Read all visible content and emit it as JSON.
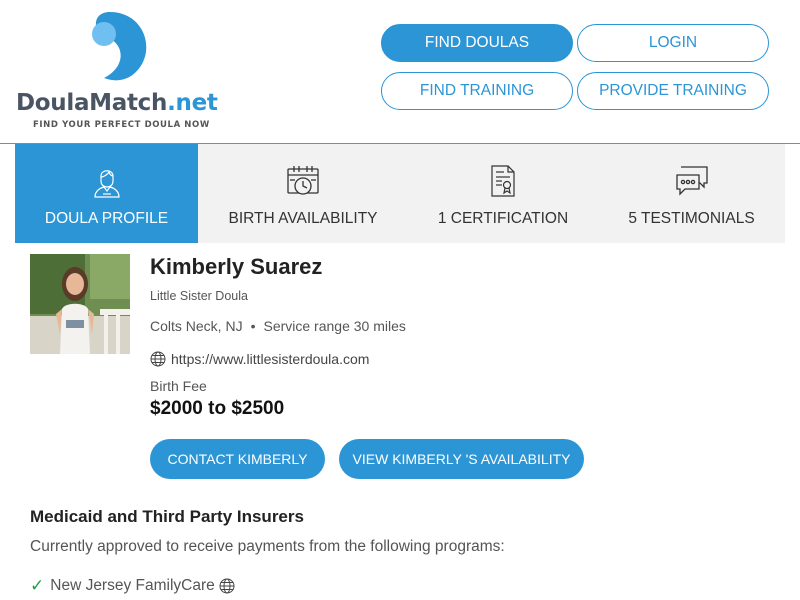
{
  "brand": {
    "name_main": "DoulaMatch",
    "name_suffix": ".net",
    "tagline": "FIND YOUR PERFECT DOULA NOW",
    "accent_color": "#2b95d6"
  },
  "nav": {
    "find_doulas": "FIND DOULAS",
    "login": "LOGIN",
    "find_training": "FIND TRAINING",
    "provide_training": "PROVIDE TRAINING"
  },
  "tabs": [
    {
      "label": "DOULA PROFILE",
      "icon": "doula-person-icon",
      "active": true
    },
    {
      "label": "BIRTH AVAILABILITY",
      "icon": "calendar-clock-icon",
      "active": false
    },
    {
      "label": "1 CERTIFICATION",
      "icon": "certificate-icon",
      "active": false
    },
    {
      "label": "5 TESTIMONIALS",
      "icon": "chat-bubbles-icon",
      "active": false
    }
  ],
  "profile": {
    "name": "Kimberly Suarez",
    "business": "Little Sister Doula",
    "location": "Colts Neck, NJ",
    "service_range": "Service range 30 miles",
    "website": "https://www.littlesisterdoula.com",
    "fee_label": "Birth Fee",
    "fee_value": "$2000 to $2500"
  },
  "actions": {
    "contact": "CONTACT KIMBERLY",
    "availability": "VIEW KIMBERLY 'S AVAILABILITY"
  },
  "insurance": {
    "title": "Medicaid and Third Party Insurers",
    "description": "Currently approved to receive payments from the following programs:",
    "programs": [
      "New Jersey FamilyCare"
    ]
  }
}
